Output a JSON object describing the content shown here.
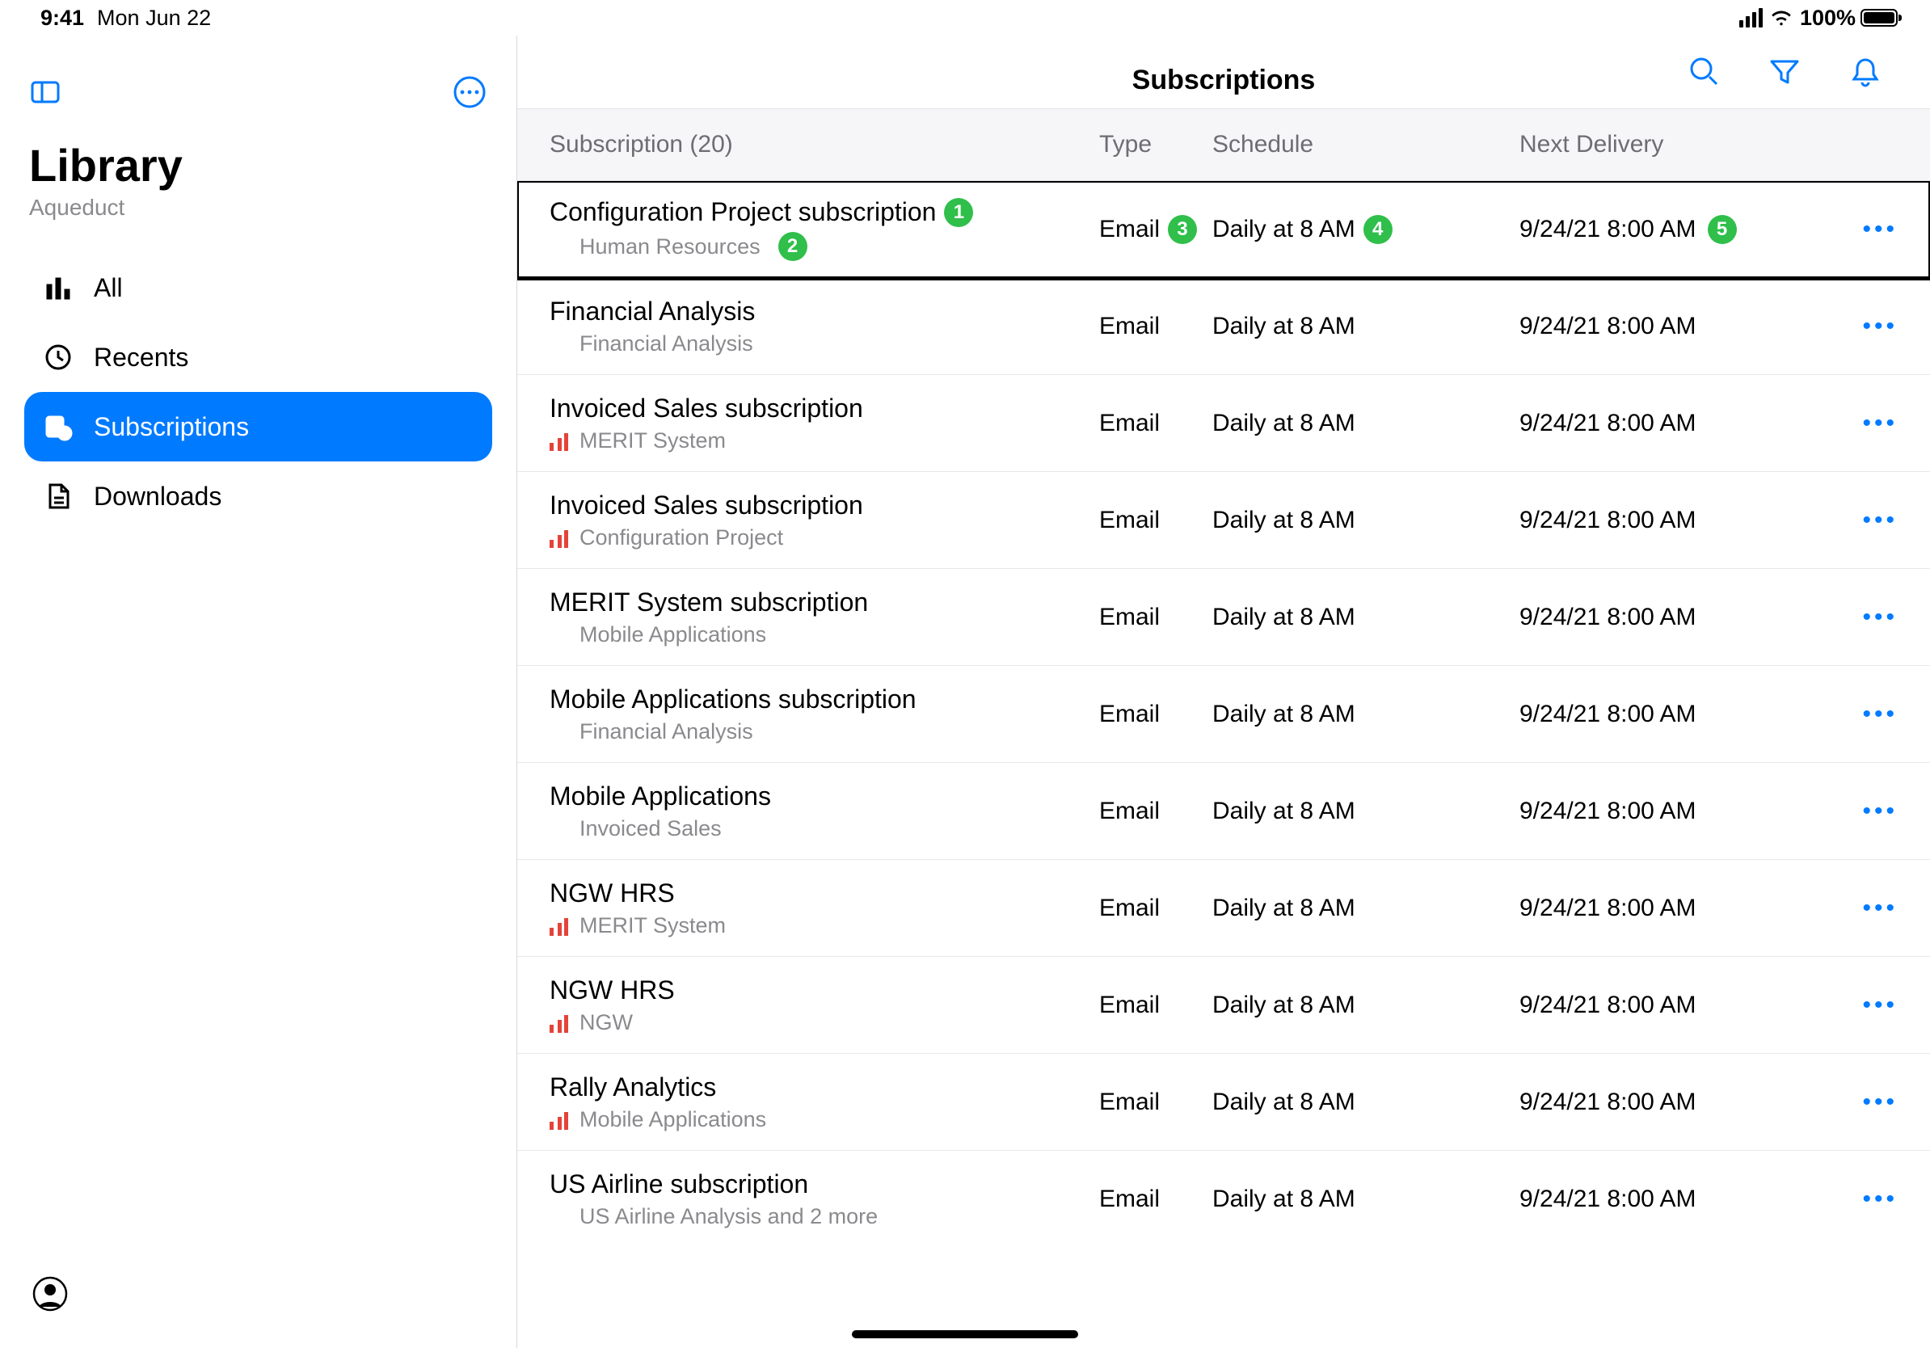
{
  "status": {
    "time": "9:41",
    "date": "Mon Jun 22",
    "battery_pct": "100%"
  },
  "sidebar": {
    "title": "Library",
    "subtitle": "Aqueduct",
    "items": [
      {
        "key": "all",
        "label": "All"
      },
      {
        "key": "recents",
        "label": "Recents"
      },
      {
        "key": "subscriptions",
        "label": "Subscriptions"
      },
      {
        "key": "downloads",
        "label": "Downloads"
      }
    ],
    "selected": "subscriptions"
  },
  "header": {
    "title": "Subscriptions"
  },
  "table": {
    "count": 20,
    "col_subscription": "Subscription (20)",
    "col_type": "Type",
    "col_schedule": "Schedule",
    "col_next": "Next Delivery"
  },
  "badges": {
    "b1": "1",
    "b2": "2",
    "b3": "3",
    "b4": "4",
    "b5": "5"
  },
  "rows": [
    {
      "name": "Configuration Project subscription",
      "source": "Human Resources",
      "srcColor": "blue",
      "type": "Email",
      "schedule": "Daily at 8 AM",
      "next": "9/24/21 8:00 AM",
      "highlight": true
    },
    {
      "name": "Financial Analysis",
      "source": "Financial Analysis",
      "srcColor": "blue",
      "type": "Email",
      "schedule": "Daily at 8 AM",
      "next": "9/24/21 8:00 AM"
    },
    {
      "name": "Invoiced Sales subscription",
      "source": "MERIT System",
      "srcColor": "red",
      "type": "Email",
      "schedule": "Daily at 8 AM",
      "next": "9/24/21 8:00 AM"
    },
    {
      "name": "Invoiced Sales subscription",
      "source": "Configuration Project",
      "srcColor": "red",
      "type": "Email",
      "schedule": "Daily at 8 AM",
      "next": "9/24/21 8:00 AM"
    },
    {
      "name": "MERIT System subscription",
      "source": "Mobile Applications",
      "srcColor": "blue",
      "type": "Email",
      "schedule": "Daily at 8 AM",
      "next": "9/24/21 8:00 AM"
    },
    {
      "name": "Mobile Applications subscription",
      "source": "Financial Analysis",
      "srcColor": "blue",
      "type": "Email",
      "schedule": "Daily at 8 AM",
      "next": "9/24/21 8:00 AM"
    },
    {
      "name": "Mobile Applications",
      "source": "Invoiced Sales",
      "srcColor": "blue",
      "type": "Email",
      "schedule": "Daily at 8 AM",
      "next": "9/24/21 8:00 AM"
    },
    {
      "name": "NGW HRS",
      "source": "MERIT System",
      "srcColor": "red",
      "type": "Email",
      "schedule": "Daily at 8 AM",
      "next": "9/24/21 8:00 AM"
    },
    {
      "name": "NGW HRS",
      "source": "NGW",
      "srcColor": "red",
      "type": "Email",
      "schedule": "Daily at 8 AM",
      "next": "9/24/21 8:00 AM"
    },
    {
      "name": "Rally Analytics",
      "source": "Mobile Applications",
      "srcColor": "red",
      "type": "Email",
      "schedule": "Daily at 8 AM",
      "next": "9/24/21 8:00 AM"
    },
    {
      "name": "US Airline subscription",
      "source": "US Airline Analysis and 2 more",
      "srcColor": "blue",
      "type": "Email",
      "schedule": "Daily at 8 AM",
      "next": "9/24/21 8:00 AM"
    }
  ]
}
